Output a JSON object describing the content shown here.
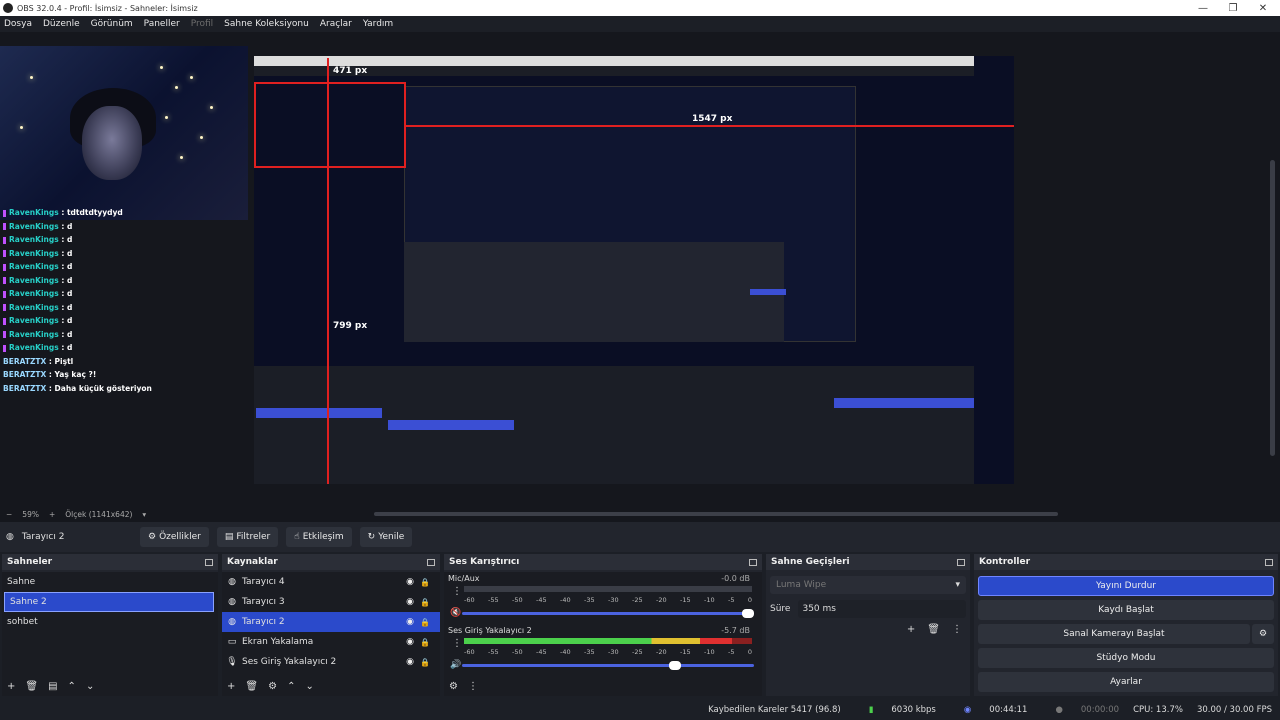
{
  "window": {
    "title": "OBS 32.0.4 - Profil: İsimsiz - Sahneler: İsimsiz",
    "minimize": "—",
    "maximize": "❐",
    "close": "✕"
  },
  "menu": [
    "Dosya",
    "Düzenle",
    "Görünüm",
    "Paneller",
    "Profil",
    "Sahne Koleksiyonu",
    "Araçlar",
    "Yardım"
  ],
  "chat": [
    {
      "user": "RavenKings",
      "msg": ": tdtdtdtyydyd"
    },
    {
      "user": "RavenKings",
      "msg": ": d"
    },
    {
      "user": "RavenKings",
      "msg": ": d"
    },
    {
      "user": "RavenKings",
      "msg": ": d"
    },
    {
      "user": "RavenKings",
      "msg": ": d"
    },
    {
      "user": "RavenKings",
      "msg": ": d"
    },
    {
      "user": "RavenKings",
      "msg": ": d"
    },
    {
      "user": "RavenKings",
      "msg": ": d"
    },
    {
      "user": "RavenKings",
      "msg": ": d"
    },
    {
      "user": "RavenKings",
      "msg": ": d"
    },
    {
      "user": "RavenKings",
      "msg": ": d"
    },
    {
      "user": "BERATZTX",
      "msg": ": Piştl"
    },
    {
      "user": "BERATZTX",
      "msg": ": Yaş kaç ?!"
    },
    {
      "user": "BERATZTX",
      "msg": ": Daha küçük gösteriyon"
    }
  ],
  "preview": {
    "measure_top": "1547 px",
    "measure_side": "799 px",
    "measure_inner": "471 px"
  },
  "zoombar": {
    "minus": "−",
    "zoom": "59%",
    "plus": "+",
    "scale": "Ölçek (1141x642)"
  },
  "context": {
    "source": "Tarayıcı 2",
    "buttons": [
      "Özellikler",
      "Filtreler",
      "Etkileşim",
      "Yenile"
    ]
  },
  "scenes": {
    "title": "Sahneler",
    "items": [
      "Sahne",
      "Sahne 2",
      "sohbet"
    ],
    "selected": 1
  },
  "sources": {
    "title": "Kaynaklar",
    "items": [
      {
        "name": "Tarayıcı 4",
        "icon": "globe-icon"
      },
      {
        "name": "Tarayıcı 3",
        "icon": "globe-icon"
      },
      {
        "name": "Tarayıcı 2",
        "icon": "globe-icon"
      },
      {
        "name": "Ekran Yakalama",
        "icon": "monitor-icon"
      },
      {
        "name": "Ses Giriş Yakalayıcı 2",
        "icon": "mic-icon"
      }
    ],
    "selected": 2
  },
  "mixer": {
    "title": "Ses Karıştırıcı",
    "tracks": [
      {
        "name": "Mic/Aux",
        "db": "-0.0 dB",
        "level": 0.0,
        "volume": 1.0
      },
      {
        "name": "Ses Giriş Yakalayıcı 2",
        "db": "-5.7 dB",
        "level": 0.93,
        "volume": 0.75
      }
    ],
    "ticks": [
      "-60",
      "-55",
      "-50",
      "-45",
      "-40",
      "-35",
      "-30",
      "-25",
      "-20",
      "-15",
      "-10",
      "-5",
      "0"
    ]
  },
  "transitions": {
    "title": "Sahne Geçişleri",
    "selected": "Luma Wipe",
    "duration_label": "Süre",
    "duration": "350 ms"
  },
  "controls": {
    "title": "Kontroller",
    "buttons": [
      "Yayını Durdur",
      "Kaydı Başlat",
      "Sanal Kamerayı Başlat",
      "Stüdyo Modu",
      "Ayarlar"
    ]
  },
  "status": {
    "dropped": "Kaybedilen Kareler 5417 (96.8)",
    "bitrate": "6030 kbps",
    "stream_time": "00:44:11",
    "rec_time": "00:00:00",
    "cpu": "CPU: 13.7%",
    "fps": "30.00 / 30.00 FPS"
  },
  "colors": {
    "accent": "#2b4acb",
    "panel": "#22252d",
    "bg": "#1c1f26",
    "guide": "#e02020"
  }
}
